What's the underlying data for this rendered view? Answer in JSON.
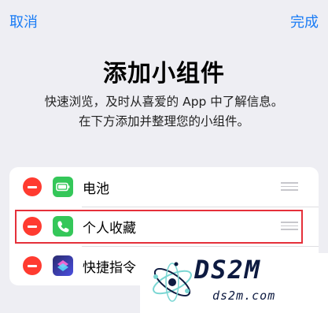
{
  "nav": {
    "cancel_label": "取消",
    "done_label": "完成"
  },
  "header": {
    "title": "添加小组件",
    "subtitle_line1": "快速浏览，及时从喜爱的 App 中了解信息。",
    "subtitle_line2": "在下方添加并整理您的小组件。"
  },
  "widgets": [
    {
      "label": "电池",
      "icon": "battery-icon"
    },
    {
      "label": "个人收藏",
      "icon": "phone-icon"
    },
    {
      "label": "快捷指令",
      "icon": "shortcuts-icon"
    }
  ],
  "colors": {
    "accent": "#1a7cf5",
    "remove": "#ff3b30",
    "highlight": "#e5303a",
    "background": "#eeeef3"
  },
  "watermark": {
    "brand": "DS2M",
    "domain": "ds2m.com"
  }
}
